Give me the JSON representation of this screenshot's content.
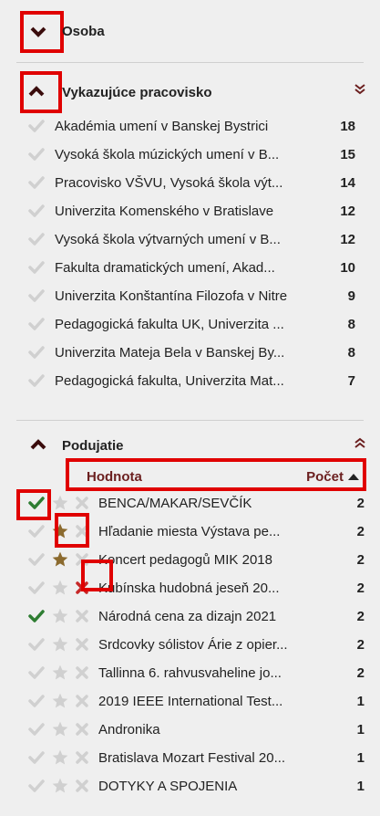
{
  "osoba": {
    "title": "Osoba"
  },
  "pracovisko": {
    "title": "Vykazujúce pracovisko",
    "items": [
      {
        "label": "Akadémia umení v Banskej Bystrici",
        "count": "18"
      },
      {
        "label": "Vysoká škola múzických umení v B...",
        "count": "15"
      },
      {
        "label": "Pracovisko VŠVU, Vysoká škola výt...",
        "count": "14"
      },
      {
        "label": "Univerzita Komenského v Bratislave",
        "count": "12"
      },
      {
        "label": "Vysoká škola výtvarných umení v B...",
        "count": "12"
      },
      {
        "label": "Fakulta dramatických umení, Akad...",
        "count": "10"
      },
      {
        "label": "Univerzita Konštantína Filozofa v Nitre",
        "count": "9"
      },
      {
        "label": "Pedagogická fakulta UK, Univerzita ...",
        "count": "8"
      },
      {
        "label": "Univerzita Mateja Bela v Banskej By...",
        "count": "8"
      },
      {
        "label": "Pedagogická fakulta, Univerzita Mat...",
        "count": "7"
      }
    ]
  },
  "podujatie": {
    "title": "Podujatie",
    "col_value": "Hodnota",
    "col_count": "Počet",
    "items": [
      {
        "label": "BENCA/MAKAR/SEVČÍK",
        "count": "2",
        "checked": true,
        "starred": false,
        "excluded": false
      },
      {
        "label": "Hľadanie miesta Výstava pe...",
        "count": "2",
        "checked": false,
        "starred": true,
        "excluded": false
      },
      {
        "label": "Koncert pedagogů MIK 2018",
        "count": "2",
        "checked": false,
        "starred": true,
        "excluded": false
      },
      {
        "label": "Kubínska hudobná jeseň 20...",
        "count": "2",
        "checked": false,
        "starred": false,
        "excluded": true
      },
      {
        "label": "Národná cena za dizajn 2021",
        "count": "2",
        "checked": true,
        "starred": false,
        "excluded": false
      },
      {
        "label": "Srdcovky sólistov Árie z opier...",
        "count": "2",
        "checked": false,
        "starred": false,
        "excluded": false
      },
      {
        "label": "Tallinna 6. rahvusvaheline jo...",
        "count": "2",
        "checked": false,
        "starred": false,
        "excluded": false
      },
      {
        "label": "2019 IEEE International Test...",
        "count": "1",
        "checked": false,
        "starred": false,
        "excluded": false
      },
      {
        "label": "Andronika",
        "count": "1",
        "checked": false,
        "starred": false,
        "excluded": false
      },
      {
        "label": "Bratislava Mozart Festival 20...",
        "count": "1",
        "checked": false,
        "starred": false,
        "excluded": false
      },
      {
        "label": "DOTYKY A SPOJENIA",
        "count": "1",
        "checked": false,
        "starred": false,
        "excluded": false
      }
    ]
  },
  "colors": {
    "accent": "#6b1f1f",
    "check_active": "#2e7d32",
    "icon_inactive": "#d0d0d0",
    "star_active": "#8b6a2e",
    "exclude_active": "#c62828",
    "highlight": "#e00000"
  }
}
